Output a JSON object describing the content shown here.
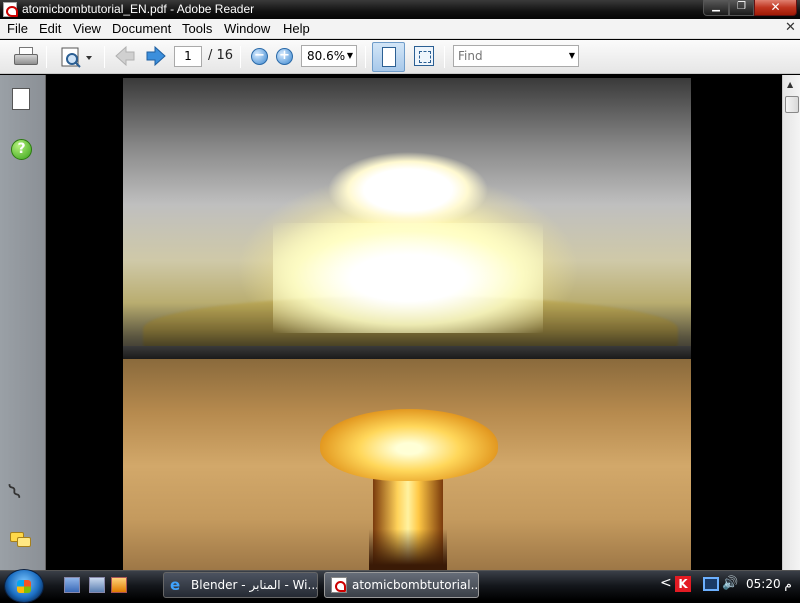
{
  "window": {
    "title": "atomicbombtutorial_EN.pdf - Adobe Reader",
    "minimize_glyph": "▁",
    "maximize_glyph": "❐",
    "close_glyph": "✕"
  },
  "menubar": {
    "items": [
      "File",
      "Edit",
      "View",
      "Document",
      "Tools",
      "Window",
      "Help"
    ],
    "close_glyph": "✕"
  },
  "toolbar": {
    "page_current": "1",
    "page_total": "/ 16",
    "zoom": "80.6%",
    "find_placeholder": "Find"
  },
  "document": {
    "images": [
      "mushroom-cloud-grayscale-explosion",
      "mushroom-cloud-orange-sepia"
    ]
  },
  "taskbar": {
    "tasks": [
      {
        "label": "Blender - المنابر - Wi...",
        "icon": "internet-explorer-icon"
      },
      {
        "label": "atomicbombtutorial...",
        "icon": "pdf-icon"
      }
    ],
    "tray_chevron": "<",
    "clock": "05:20 م"
  },
  "colors": {
    "titlebar": "#111111",
    "close_button": "#c03520",
    "accent_blue": "#2e86d8",
    "nav_panel": "#8b9096"
  }
}
